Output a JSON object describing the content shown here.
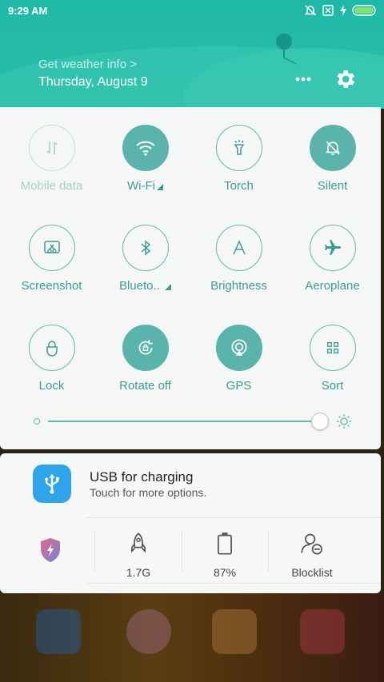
{
  "status_bar": {
    "time": "9:29 AM",
    "icons": [
      "mute-notification-icon",
      "sim-x-icon",
      "charging-bolt-icon",
      "battery-icon"
    ]
  },
  "header": {
    "weather_link": "Get weather info >",
    "date": "Thursday, August 9",
    "more_icon": "more-dots-icon",
    "settings_icon": "gear-icon"
  },
  "toggles": [
    {
      "label": "Mobile data",
      "icon": "mobile-data-icon",
      "state": "unavailable"
    },
    {
      "label": "Wi-Fi",
      "icon": "wifi-icon",
      "state": "on"
    },
    {
      "label": "Torch",
      "icon": "torch-icon",
      "state": "off"
    },
    {
      "label": "Silent",
      "icon": "silent-bell-icon",
      "state": "on"
    },
    {
      "label": "Screenshot",
      "icon": "screenshot-icon",
      "state": "off"
    },
    {
      "label": "Blueto..",
      "icon": "bluetooth-icon",
      "state": "off"
    },
    {
      "label": "Brightness",
      "icon": "brightness-auto-icon",
      "state": "off"
    },
    {
      "label": "Aeroplane",
      "icon": "aeroplane-icon",
      "state": "off"
    },
    {
      "label": "Lock",
      "icon": "lock-icon",
      "state": "off"
    },
    {
      "label": "Rotate off",
      "icon": "rotate-lock-icon",
      "state": "on"
    },
    {
      "label": "GPS",
      "icon": "gps-icon",
      "state": "on"
    },
    {
      "label": "Sort",
      "icon": "sort-grid-icon",
      "state": "off"
    }
  ],
  "brightness": {
    "level": 0.95
  },
  "notification": {
    "title": "USB for charging",
    "subtitle": "Touch for more options."
  },
  "quick_stats": [
    {
      "label": "1.7G",
      "icon": "rocket-icon"
    },
    {
      "label": "87%",
      "icon": "battery-outline-icon"
    },
    {
      "label": "Blocklist",
      "icon": "blocklist-user-icon"
    }
  ],
  "colors": {
    "accent": "#5bb4ab",
    "header": "#25bba8",
    "usb": "#2fa4ea"
  }
}
